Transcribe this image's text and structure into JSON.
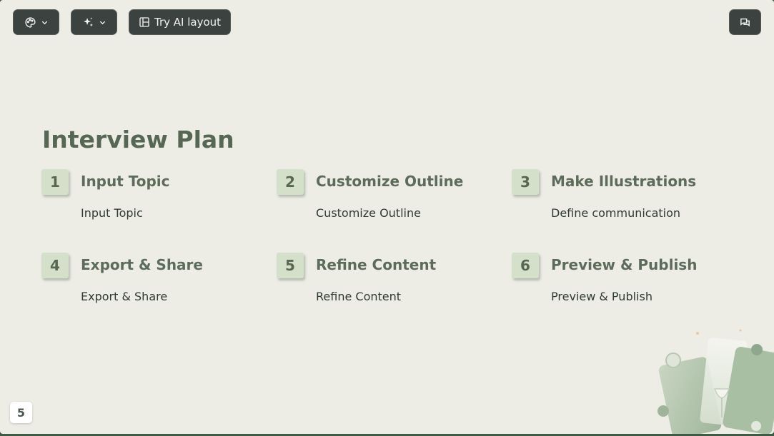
{
  "toolbar": {
    "theme_icon": "palette-icon",
    "ai_icon": "sparkle-icon",
    "layout_icon": "layout-icon",
    "layout_label": "Try AI layout",
    "comment_icon": "comment-icon"
  },
  "slide": {
    "title": "Interview Plan",
    "steps": [
      {
        "num": "1",
        "title": "Input Topic",
        "desc": "Input Topic"
      },
      {
        "num": "2",
        "title": "Customize Outline",
        "desc": "Customize Outline"
      },
      {
        "num": "3",
        "title": "Make Illustrations",
        "desc": "Define communication"
      },
      {
        "num": "4",
        "title": "Export & Share",
        "desc": "Export & Share"
      },
      {
        "num": "5",
        "title": "Refine Content",
        "desc": "Refine Content"
      },
      {
        "num": "6",
        "title": "Preview & Publish",
        "desc": "Preview & Publish"
      }
    ],
    "page_number": "5"
  },
  "colors": {
    "background": "#edede6",
    "accent_box": "#d5e0ca",
    "title": "#566754",
    "toolbar": "#3c4240"
  }
}
